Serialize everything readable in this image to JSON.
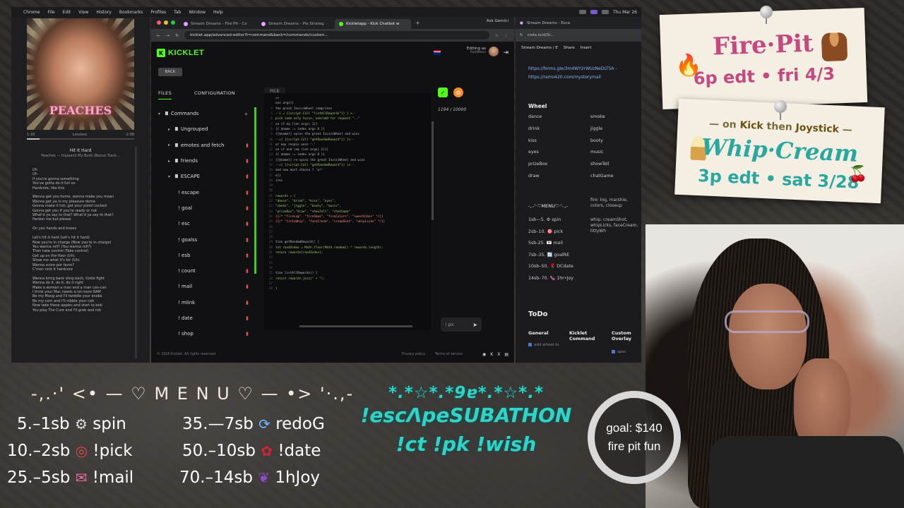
{
  "menubar": {
    "items": [
      "Chrome",
      "File",
      "Edit",
      "View",
      "History",
      "Bookmarks",
      "Profiles",
      "Tab",
      "Window",
      "Help"
    ],
    "clock": "Thu Mar 26"
  },
  "music": {
    "album_word": "PEACHES",
    "elapsed": "1:18",
    "quality": "Lossless",
    "remaining": "-2:08",
    "progress": 0.12,
    "title": "Hit It Hard",
    "artist": "Peaches — Impeach My Bush (Bonus Track...",
    "lyrics": "Uh\nUh\nIf you're gonna something\nYou've gotta do it full on\nHardcore, like this\n\nWanna get you home, wanna make you moan\nWanna get ya in my pleasure dome\nGonna make it hot, get your pistol cocked\nGonna get you if you're ready or not\nWhat'd ya say to that? What'd ya say to that?\nPardon me but please\n\nOn you hands and knees\n\nLet's hit it hard (Let's hit it hard)\nNow you're in charge (Now you're in charge)\nYou wanna roll? (You wanna roll?)\nThen take control (Take control)\nGet up on the floor (Uh)\nShow me what it's for (Uh)\nWanna score por favor?\nC'mon rock it hardcore\n\nWanna bring back sling-back, tickle fight\nWanna do it, do it, do it right\nMake a woman a man and a man can-can\nI think your Mac needs a lot more RAM\nBe my Moog and I'll twiddle your knobs\nBe my corn and I'll nibble your cob\nNow take these apples and start to bob\nYou play The Cure and I'll grab and rob"
  },
  "chrome": {
    "tabs": [
      {
        "label": "Stream Dreams - Fire Pit - Co"
      },
      {
        "label": "Stream Dreams - Pie Strateg"
      },
      {
        "label": "Kickletapp - Kick Chatbot w"
      }
    ],
    "ask_gemini": "Ask Gemini",
    "url": "kicklet.app/advanced-editor?t=command&back=/commands/custom..."
  },
  "kicklet": {
    "logo": "KICKLET",
    "editing_label": "Editing as",
    "editing_user": "RadiMoon",
    "back": "BACK",
    "tab_files": "FILES",
    "tab_config": "CONFIGURATION",
    "pick_tab": "PICK",
    "counter": "1194 / 10000",
    "test_placeholder": "! pic",
    "tree": [
      {
        "label": "Commands",
        "level": 0,
        "caret": "▾",
        "icon": "folder",
        "action": "plus"
      },
      {
        "label": "Ungrouped",
        "level": 1,
        "caret": "▸",
        "icon": "folder"
      },
      {
        "label": "emotes and fetch",
        "level": 1,
        "caret": "▸",
        "icon": "folder",
        "action": "trash"
      },
      {
        "label": "friends",
        "level": 1,
        "caret": "▸",
        "icon": "folder",
        "action": "trash"
      },
      {
        "label": "ESCAPE",
        "level": 1,
        "caret": "▾",
        "icon": "folder",
        "action": "trash"
      },
      {
        "label": "! escape",
        "level": 2,
        "action": "trash"
      },
      {
        "label": "! goal",
        "level": 2,
        "action": "trash"
      },
      {
        "label": "! esc",
        "level": 2,
        "action": "trash"
      },
      {
        "label": "! goalss",
        "level": 2,
        "action": "trash"
      },
      {
        "label": "! esb",
        "level": 2,
        "action": "trash"
      },
      {
        "label": "! count",
        "level": 2,
        "action": "trash"
      },
      {
        "label": "! mail",
        "level": 2,
        "action": "trash"
      },
      {
        "label": "! mlink",
        "level": 2,
        "action": "trash"
      },
      {
        "label": "! date",
        "level": 2,
        "action": "trash"
      },
      {
        "label": "! shop",
        "level": 2,
        "action": "trash"
      }
    ],
    "code": [
      {
        "n": "",
        "t": "=>"
      },
      {
        "n": "",
        "t": "  out args}}"
      },
      {
        "n": "4",
        "t": "  the great InvisiWheel comprises"
      },
      {
        "n": "5",
        "t": "--{ = {{script.Call \"listAllRewards\"}} } >--"
      },
      {
        "n": "6",
        "t": "pick some only twice, ask/add for request \"..\""
      },
      {
        "n": "7",
        "t": "se if eq (len args) 1}}"
      },
      {
        "n": "8",
        "t": "{{ $name := index args 0 }}"
      },
      {
        "n": "9",
        "t": "  {{$name}} spins the great InvisiWheel and wins"
      },
      {
        "n": "10",
        "t": "--={ {{script.Call \"getRandomReward\"}} }>--"
      },
      {
        "n": "11",
        "t": "or may respin once '-'"
      },
      {
        "n": "12",
        "t": "se if and (eq (len args) 2)}}"
      },
      {
        "n": "13",
        "t": "{{ $name := index args 0 }}"
      },
      {
        "n": "14",
        "t": "  {{$name}} re-spins the great InvisiWheel and wins"
      },
      {
        "n": "15",
        "t": "--={ {{script.Call \"getRandomReward\"}} }>--"
      },
      {
        "n": "16",
        "t": "and now must choose ? 'or'"
      },
      {
        "n": "17",
        "t": "e}}"
      },
      {
        "n": "18",
        "t": "ire>"
      },
      {
        "n": "19",
        "t": ""
      },
      {
        "n": "20",
        "t": ""
      },
      {
        "n": "21",
        "t": "rewards = ["
      },
      {
        "n": "22",
        "t": " \"dance\", \"drink\", \"kiss\", \"eyes\","
      },
      {
        "n": "23",
        "t": " \"smoke\", \"jiggle\", \"booty\", \"music\","
      },
      {
        "n": "24",
        "t": " \"prizeBox\",\"draw\", \"showTell\", \"chatGame\""
      },
      {
        "n": "24",
        "t": "{{/* \"fireLog\", \"fireSmoo\", \"fireColors\", \"sweetVibes\" */}}"
      },
      {
        "n": "25",
        "t": "{{/* \"tittyWhip\", \"faceCream\", \"creamShot\", \"whipLicks\" */}}"
      },
      {
        "n": "26",
        "t": ""
      },
      {
        "n": "27",
        "t": ""
      },
      {
        "n": "28",
        "t": ""
      },
      {
        "n": "29",
        "t": "tion getRandomReward() {"
      },
      {
        "n": "30",
        "t": "let randIndex = Math.floor(Math.random() * rewards.length);"
      },
      {
        "n": "31",
        "t": "return rewards[randIndex];"
      },
      {
        "n": "32",
        "t": ""
      },
      {
        "n": "33",
        "t": ""
      },
      {
        "n": "34",
        "t": ""
      },
      {
        "n": "35",
        "t": "tion listAllRewards() {"
      },
      {
        "n": "36",
        "t": "return rewards.join(\" • \");"
      },
      {
        "n": "37",
        "t": ""
      },
      {
        "n": "38",
        "t": "}"
      }
    ],
    "footer": {
      "copyright": "© 2026 Kicklet. All rights reserved",
      "privacy": "Privacy policy",
      "terms": "Terms of service"
    }
  },
  "coda": {
    "tab": "Stream Dreams - Esca",
    "url": "coda.io/d/St...",
    "doc": "Stream Dreams / E",
    "share": "Share",
    "insert": "Insert",
    "link1": "https://forms.gle/3m4WY2rWUzNeDLT5A -",
    "link2": "https://ramo420.com/mysterymail",
    "wheel_heading": "Wheel",
    "wheel_left": [
      "dance",
      "drink",
      "kiss",
      "eyes",
      "prizeBox",
      "draw"
    ],
    "wheel_right": [
      "smoke",
      "jiggle",
      "booty",
      "music",
      "showTell",
      "chatGame"
    ],
    "menu_heading": "-,.-'·♡MENU♡·'-.,-",
    "menu_items": [
      "1sb—5. ⚙ spin",
      "2sb–10. 🎯 pick",
      "5sb-25. 💌 mail",
      "7sb–35. 🔄 goalRE",
      "10sb–50. 🌹 DCdate",
      "14sb–70. 🍆 1hr•Joy"
    ],
    "note1": "fire: log, marshie, colors, closeup",
    "note2": "whip: creamShot, whipLicks, faceCream, tittyWh",
    "todo_heading": "ToDo",
    "todo_cols": [
      "General",
      "Kicklet Command",
      "Custom Overlay"
    ],
    "todo_item1": "add wheel to",
    "todo_item3": "spec"
  },
  "sticky1": {
    "title": "Fire·Pit",
    "time": "6p edt • fri 4/3"
  },
  "sticky2": {
    "sub_pre": "— on ",
    "sub_kick": "Kick",
    "sub_mid": " then ",
    "sub_joy": "Joystick",
    "sub_post": " —",
    "title": "Whip·Cream",
    "time": "3p edt • sat 3/28"
  },
  "goal": {
    "line1": "goal: $140",
    "line2": "fire pit fun"
  },
  "overlay_menu": {
    "title": "-,.·' <• — ♡ M E N U ♡ — •> '·.,-",
    "rows": [
      {
        "left": "5.–1sb",
        "icon": "gear",
        "label": "spin"
      },
      {
        "left": "10.–2sb",
        "icon": "dart",
        "label": "!pick"
      },
      {
        "left": "25.–5sb",
        "icon": "mail",
        "label": "!mail"
      }
    ],
    "rows_right": [
      {
        "left": "35.—7sb",
        "icon": "redo",
        "label": "redoG"
      },
      {
        "left": "50.–10sb",
        "icon": "rose",
        "label": "!date"
      },
      {
        "left": "70.–14sb",
        "icon": "eggplant",
        "label": "1hJoy"
      }
    ]
  },
  "subathon": {
    "stars": "*.*☆*.*9ɐ*.*☆*.*",
    "title": "!escΛpeSUBATHON",
    "commands": "!ct !pk !wish"
  },
  "colors": {
    "kick_green": "#53fc18",
    "teal_text": "#2fd3c8",
    "pink_text": "#c5487e"
  }
}
